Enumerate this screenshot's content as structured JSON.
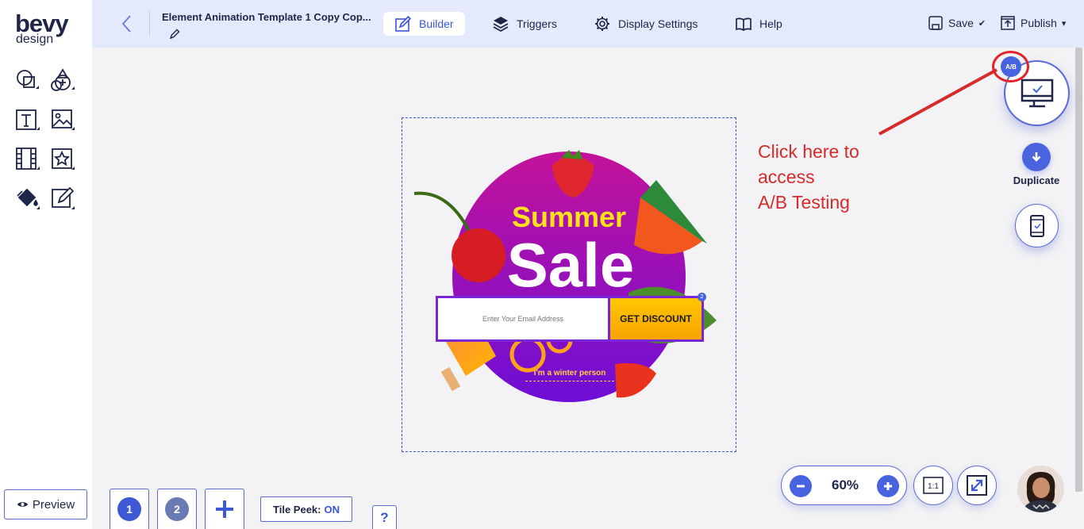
{
  "brand": {
    "name": "bevy",
    "sub": "design"
  },
  "document": {
    "title": "Element Animation Template 1 Copy Cop..."
  },
  "nav": {
    "builder": "Builder",
    "triggers": "Triggers",
    "display_settings": "Display Settings",
    "help": "Help"
  },
  "actions": {
    "save": "Save",
    "publish": "Publish"
  },
  "sidebar": {
    "tools": [
      "shape-tool-icon",
      "add-element-icon",
      "text-tool-icon",
      "image-tool-icon",
      "video-tool-icon",
      "sticker-tool-icon",
      "fill-tool-icon",
      "edit-tool-icon"
    ],
    "preview": "Preview"
  },
  "popup": {
    "headline_1": "Summer",
    "headline_2": "Sale",
    "email_placeholder": "Enter Your Email Address",
    "cta": "GET DISCOUNT",
    "badge": "2",
    "secondary_link": "I'm a winter person"
  },
  "annotation": {
    "line1": "Click here to",
    "line2": "access",
    "line3": "A/B Testing"
  },
  "right_panel": {
    "ab_badge": "A/B",
    "duplicate": "Duplicate"
  },
  "steps": [
    "1",
    "2"
  ],
  "tile_peek": {
    "label": "Tile Peek:",
    "value": "ON"
  },
  "help_button": "?",
  "zoom": {
    "value": "60%"
  },
  "fit_label": "1:1",
  "colors": {
    "accent": "#4763e0",
    "annotation": "#d72a2a",
    "topbar": "#e4e9fb",
    "cta": "#ffc700"
  }
}
